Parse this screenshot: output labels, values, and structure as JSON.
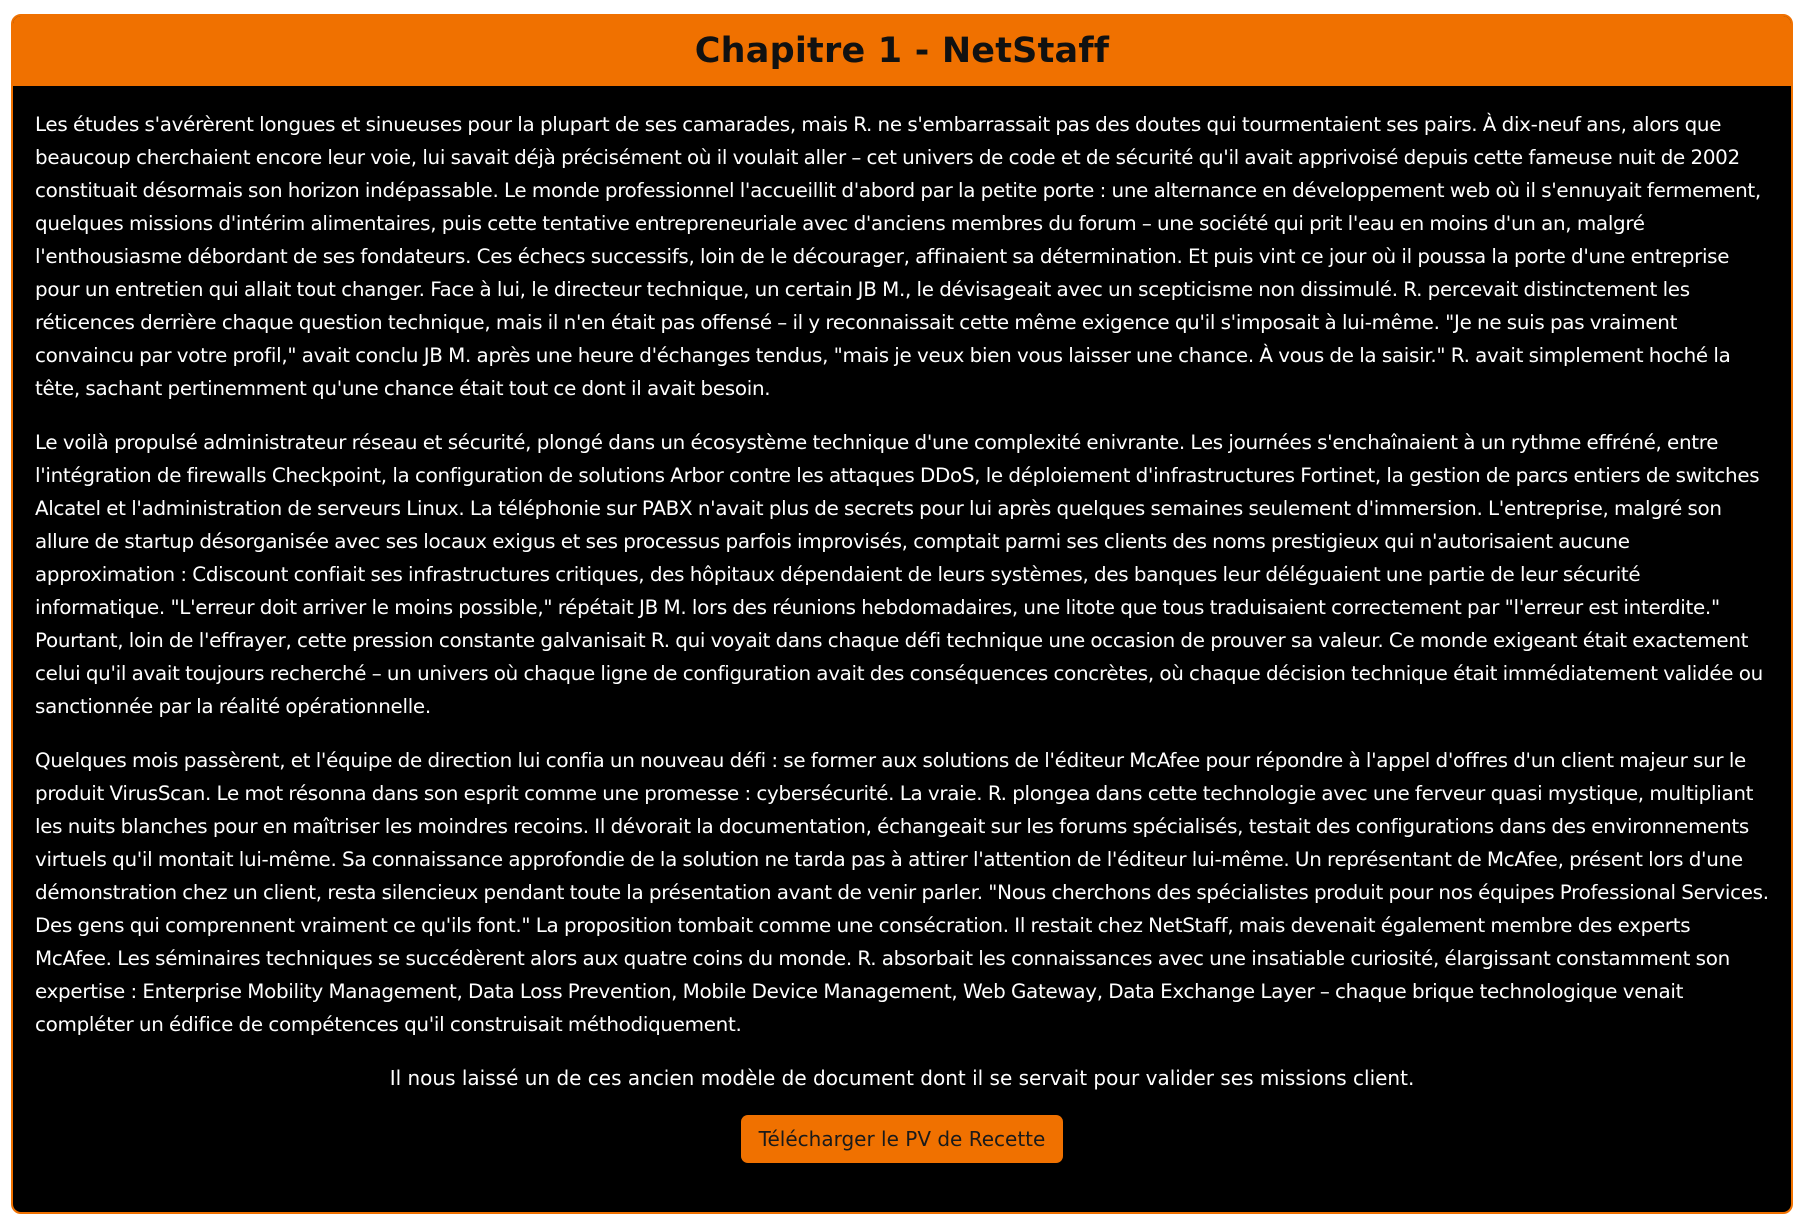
{
  "chapter": {
    "title": "Chapitre 1 - NetStaff"
  },
  "paragraphs": [
    "Les études s'avérèrent longues et sinueuses pour la plupart de ses camarades, mais R. ne s'embarrassait pas des doutes qui tourmentaient ses pairs. À dix-neuf ans, alors que beaucoup cherchaient encore leur voie, lui savait déjà précisément où il voulait aller – cet univers de code et de sécurité qu'il avait apprivoisé depuis cette fameuse nuit de 2002 constituait désormais son horizon indépassable. Le monde professionnel l'accueillit d'abord par la petite porte : une alternance en développement web où il s'ennuyait fermement, quelques missions d'intérim alimentaires, puis cette tentative entrepreneuriale avec d'anciens membres du forum – une société qui prit l'eau en moins d'un an, malgré l'enthousiasme débordant de ses fondateurs. Ces échecs successifs, loin de le décourager, affinaient sa détermination. Et puis vint ce jour où il poussa la porte d'une entreprise pour un entretien qui allait tout changer. Face à lui, le directeur technique, un certain JB M., le dévisageait avec un scepticisme non dissimulé. R. percevait distinctement les réticences derrière chaque question technique, mais il n'en était pas offensé – il y reconnaissait cette même exigence qu'il s'imposait à lui-même. \"Je ne suis pas vraiment convaincu par votre profil,\" avait conclu JB M. après une heure d'échanges tendus, \"mais je veux bien vous laisser une chance. À vous de la saisir.\" R. avait simplement hoché la tête, sachant pertinemment qu'une chance était tout ce dont il avait besoin.",
    "Le voilà propulsé administrateur réseau et sécurité, plongé dans un écosystème technique d'une complexité enivrante. Les journées s'enchaînaient à un rythme effréné, entre l'intégration de firewalls Checkpoint, la configuration de solutions Arbor contre les attaques DDoS, le déploiement d'infrastructures Fortinet, la gestion de parcs entiers de switches Alcatel et l'administration de serveurs Linux. La téléphonie sur PABX n'avait plus de secrets pour lui après quelques semaines seulement d'immersion. L'entreprise, malgré son allure de startup désorganisée avec ses locaux exigus et ses processus parfois improvisés, comptait parmi ses clients des noms prestigieux qui n'autorisaient aucune approximation : Cdiscount confiait ses infrastructures critiques, des hôpitaux dépendaient de leurs systèmes, des banques leur déléguaient une partie de leur sécurité informatique. \"L'erreur doit arriver le moins possible,\" répétait JB M. lors des réunions hebdomadaires, une litote que tous traduisaient correctement par \"l'erreur est interdite.\" Pourtant, loin de l'effrayer, cette pression constante galvanisait R. qui voyait dans chaque défi technique une occasion de prouver sa valeur. Ce monde exigeant était exactement celui qu'il avait toujours recherché – un univers où chaque ligne de configuration avait des conséquences concrètes, où chaque décision technique était immédiatement validée ou sanctionnée par la réalité opérationnelle.",
    "Quelques mois passèrent, et l'équipe de direction lui confia un nouveau défi : se former aux solutions de l'éditeur McAfee pour répondre à l'appel d'offres d'un client majeur sur le produit VirusScan. Le mot résonna dans son esprit comme une promesse : cybersécurité. La vraie. R. plongea dans cette technologie avec une ferveur quasi mystique, multipliant les nuits blanches pour en maîtriser les moindres recoins. Il dévorait la documentation, échangeait sur les forums spécialisés, testait des configurations dans des environnements virtuels qu'il montait lui-même. Sa connaissance approfondie de la solution ne tarda pas à attirer l'attention de l'éditeur lui-même. Un représentant de McAfee, présent lors d'une démonstration chez un client, resta silencieux pendant toute la présentation avant de venir parler. \"Nous cherchons des spécialistes produit pour nos équipes Professional Services. Des gens qui comprennent vraiment ce qu'ils font.\" La proposition tombait comme une consécration. Il restait chez NetStaff, mais devenait également membre des experts McAfee. Les séminaires techniques se succédèrent alors aux quatre coins du monde. R. absorbait les connaissances avec une insatiable curiosité, élargissant constamment son expertise : Enterprise Mobility Management, Data Loss Prevention, Mobile Device Management, Web Gateway, Data Exchange Layer – chaque brique technologique venait compléter un édifice de compétences qu'il construisait méthodiquement."
  ],
  "note": "Il nous laissé un de ces ancien modèle de document dont il se servait pour valider ses missions client.",
  "download_button": {
    "label": "Télécharger le PV de Recette"
  },
  "colors": {
    "accent": "#f07100",
    "background": "#000000",
    "text": "#ffffff",
    "title_text": "#111111"
  }
}
